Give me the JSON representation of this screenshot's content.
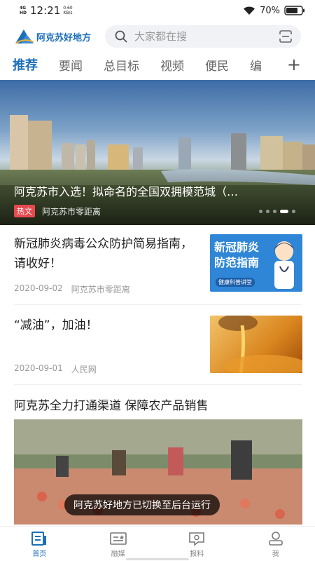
{
  "status_bar": {
    "network": "4G",
    "network_sub": "HD",
    "time": "12:21",
    "speed_value": "0.60",
    "speed_unit": "KB/s",
    "battery": "70%"
  },
  "header": {
    "logo_text": "阿克苏好地方",
    "search_placeholder": "大家都在搜"
  },
  "tabs": [
    {
      "label": "推荐",
      "active": true
    },
    {
      "label": "要闻",
      "active": false
    },
    {
      "label": "总目标",
      "active": false
    },
    {
      "label": "视频",
      "active": false
    },
    {
      "label": "便民",
      "active": false
    },
    {
      "label": "编",
      "active": false
    }
  ],
  "hero": {
    "title": "阿克苏市入选！拟命名的全国双拥模范城（…",
    "tag": "热文",
    "source": "阿克苏市零距离",
    "slide_count": 5,
    "active_slide": 3
  },
  "articles": [
    {
      "title": "新冠肺炎病毒公众防护简易指南，请收好！",
      "date": "2020-09-02",
      "source": "阿克苏市零距离",
      "thumb_line1": "新冠肺炎",
      "thumb_line2": "防范指南",
      "thumb_caption": "健康科普讲堂"
    },
    {
      "title": "“减油”，加油！",
      "date": "2020-09-01",
      "source": "人民网"
    }
  ],
  "video_article": {
    "title": "阿克苏全力打通渠道 保障农产品销售"
  },
  "toast": "阿克苏好地方已切换至后台运行",
  "bottom_nav": [
    {
      "label": "首页",
      "icon": "home-icon",
      "active": true
    },
    {
      "label": "融媒",
      "icon": "media-icon",
      "active": false
    },
    {
      "label": "报料",
      "icon": "report-icon",
      "active": false
    },
    {
      "label": "我",
      "icon": "profile-icon",
      "active": false
    }
  ],
  "colors": {
    "brand": "#1c6fb8",
    "hot_tag": "#e7494f"
  }
}
